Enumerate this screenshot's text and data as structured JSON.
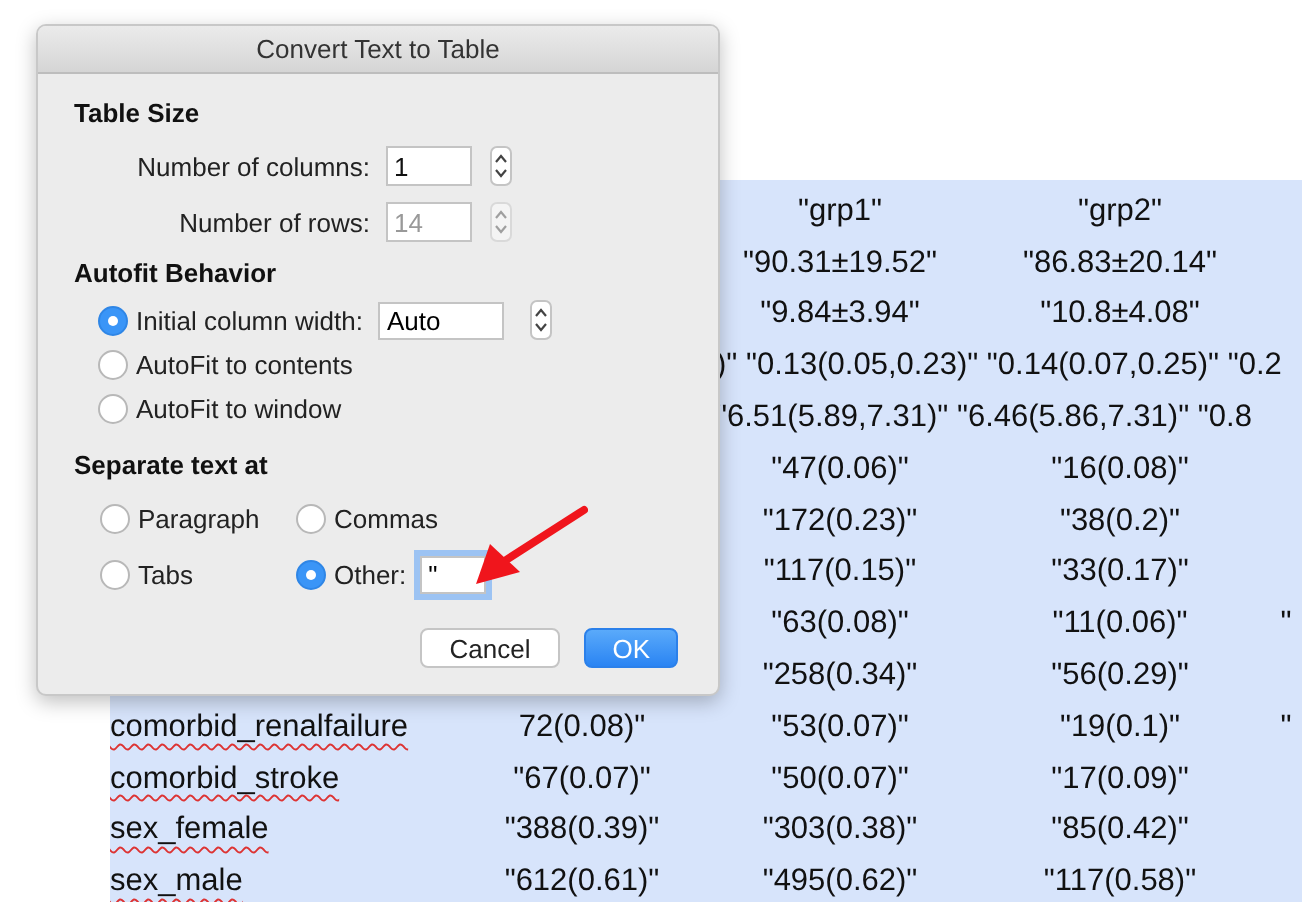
{
  "document": {
    "rows": [
      {
        "kind": "normal",
        "cells": [
          "",
          "\"grp1\"",
          "\"grp2\""
        ]
      },
      {
        "kind": "normal",
        "cells": [
          "",
          "\"90.31±19.52\"",
          "\"86.83±20.14\""
        ]
      },
      {
        "kind": "normal",
        "cells": [
          "",
          "\"9.84±3.94\"",
          "\"10.8±4.08\""
        ]
      },
      {
        "kind": "wide",
        "cells": [
          "",
          ")\" \"0.13(0.05,0.23)\" \"0.14(0.07,0.25)\" \"0.2"
        ]
      },
      {
        "kind": "wide",
        "cells": [
          "",
          "\"6.51(5.89,7.31)\" \"6.46(5.86,7.31)\" \"0.8"
        ]
      },
      {
        "kind": "normal",
        "cells": [
          "",
          "\"47(0.06)\"",
          "\"16(0.08)\""
        ]
      },
      {
        "kind": "normal",
        "cells": [
          "",
          "\"172(0.23)\"",
          "\"38(0.2)\""
        ]
      },
      {
        "kind": "normal",
        "cells": [
          "",
          "\"117(0.15)\"",
          "\"33(0.17)\""
        ]
      },
      {
        "kind": "normal",
        "cells": [
          "",
          "\"63(0.08)\"",
          "\"11(0.06)\"",
          "\""
        ]
      },
      {
        "kind": "normal",
        "cells": [
          "",
          "\"258(0.34)\"",
          "\"56(0.29)\""
        ]
      },
      {
        "kind": "normal",
        "label": "comorbid_renalfailure",
        "cells": [
          "72(0.08)\"",
          "\"53(0.07)\"",
          "\"19(0.1)\"",
          "\""
        ]
      },
      {
        "kind": "normal",
        "label": "comorbid_stroke",
        "cells": [
          "\"67(0.07)\"",
          "\"50(0.07)\"",
          "\"17(0.09)\""
        ]
      },
      {
        "kind": "normal",
        "label": "sex_female",
        "cells": [
          "\"388(0.39)\"",
          "\"303(0.38)\"",
          "\"85(0.42)\""
        ]
      },
      {
        "kind": "normal",
        "label": "sex_male",
        "cells": [
          "\"612(0.61)\"",
          "\"495(0.62)\"",
          "\"117(0.58)\""
        ]
      }
    ]
  },
  "dialog": {
    "title": "Convert Text to Table",
    "table_size": {
      "heading": "Table Size",
      "fields": [
        {
          "label": "Number of columns:",
          "value": "1",
          "disabled": false
        },
        {
          "label": "Number of rows:",
          "value": "14",
          "disabled": true
        }
      ]
    },
    "autofit": {
      "heading": "Autofit Behavior",
      "options": [
        {
          "label": "Initial column width:",
          "selected": true,
          "value": "Auto"
        },
        {
          "label": "AutoFit to contents",
          "selected": false
        },
        {
          "label": "AutoFit to window",
          "selected": false
        }
      ]
    },
    "separate": {
      "heading": "Separate text at",
      "options": [
        {
          "label": "Paragraph",
          "selected": false
        },
        {
          "label": "Commas",
          "selected": false
        },
        {
          "label": "Tabs",
          "selected": false
        },
        {
          "label": "Other:",
          "selected": true,
          "value": "\""
        }
      ]
    },
    "buttons": [
      {
        "label": "Cancel",
        "kind": "secondary"
      },
      {
        "label": "OK",
        "kind": "default"
      }
    ]
  }
}
